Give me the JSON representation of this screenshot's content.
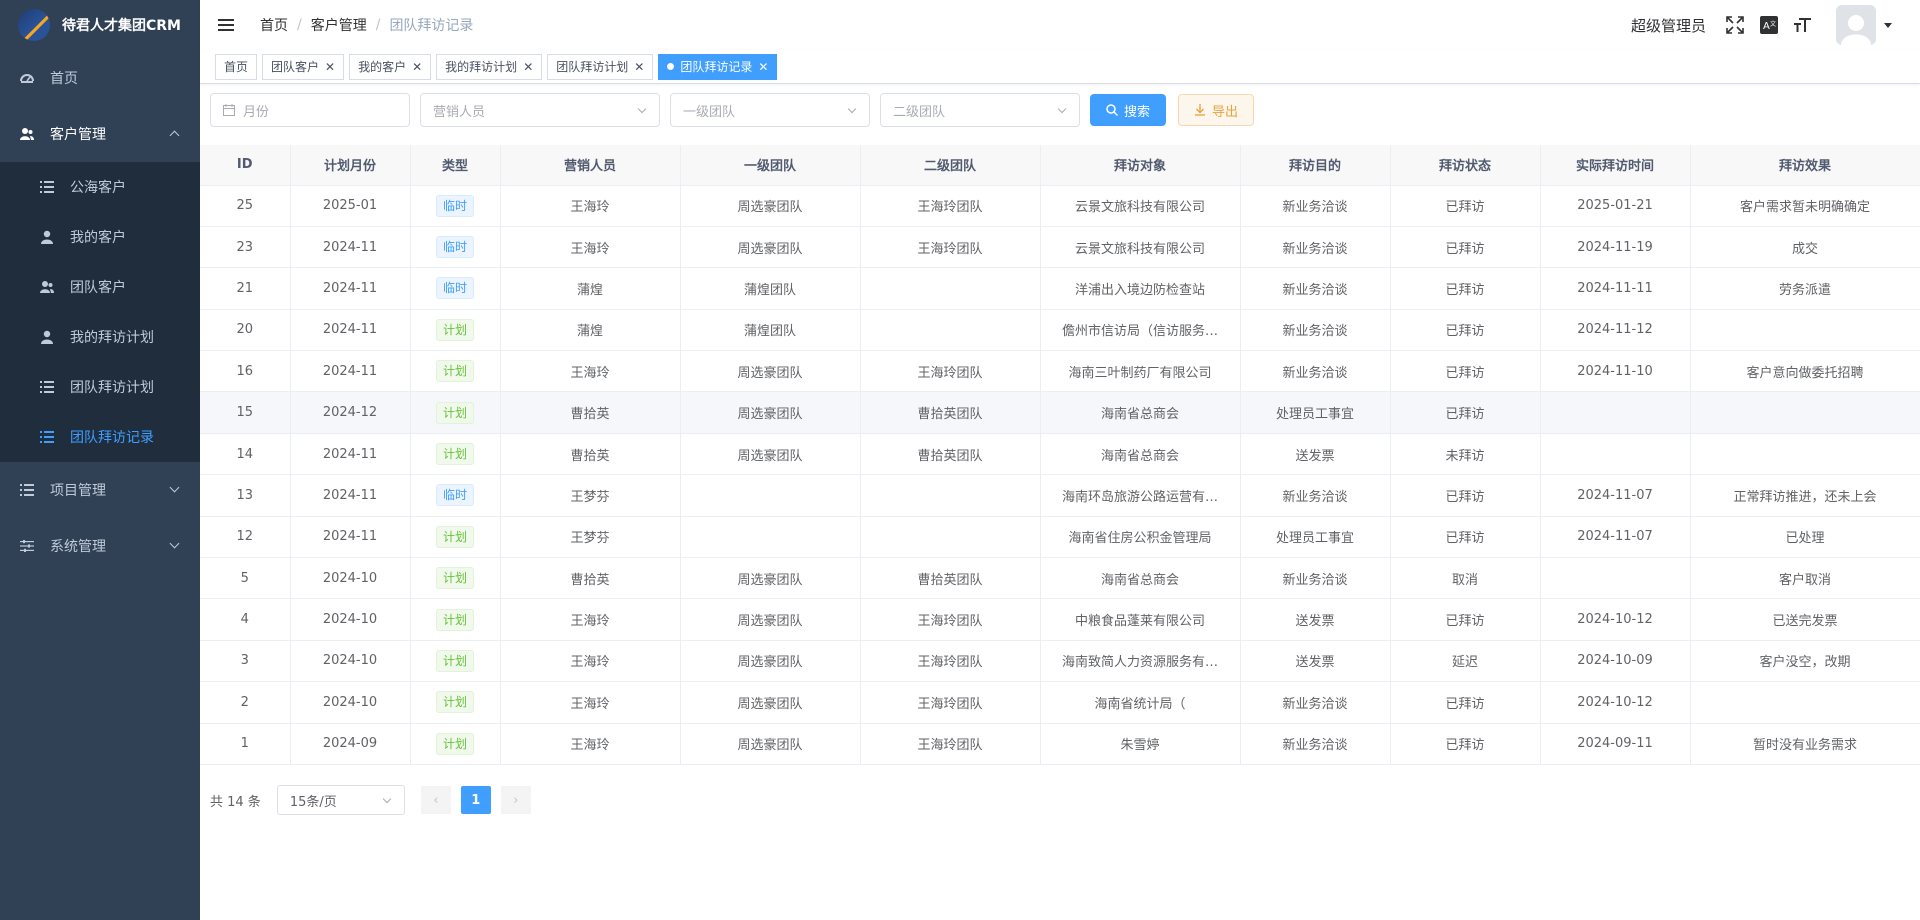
{
  "app": {
    "title": "待君人才集团CRM"
  },
  "sidebar": {
    "home": "首页",
    "customer_mgmt": "客户管理",
    "sub_items": [
      "公海客户",
      "我的客户",
      "团队客户",
      "我的拜访计划",
      "团队拜访计划",
      "团队拜访记录"
    ],
    "project_mgmt": "项目管理",
    "system_mgmt": "系统管理"
  },
  "header": {
    "breadcrumb": [
      "首页",
      "客户管理",
      "团队拜访记录"
    ],
    "username": "超级管理员"
  },
  "tags": [
    "首页",
    "团队客户",
    "我的客户",
    "我的拜访计划",
    "团队拜访计划",
    "团队拜访记录"
  ],
  "filters": {
    "month_placeholder": "月份",
    "sales_placeholder": "营销人员",
    "team1_placeholder": "一级团队",
    "team2_placeholder": "二级团队",
    "search_label": "搜索",
    "export_label": "导出"
  },
  "table": {
    "headers": [
      "ID",
      "计划月份",
      "类型",
      "营销人员",
      "一级团队",
      "二级团队",
      "拜访对象",
      "拜访目的",
      "拜访状态",
      "实际拜访时间",
      "拜访效果"
    ],
    "rows": [
      [
        "25",
        "2025-01",
        "临时",
        "王海玲",
        "周选豪团队",
        "王海玲团队",
        "云景文旅科技有限公司",
        "新业务洽谈",
        "已拜访",
        "2025-01-21",
        "客户需求暂未明确确定"
      ],
      [
        "23",
        "2024-11",
        "临时",
        "王海玲",
        "周选豪团队",
        "王海玲团队",
        "云景文旅科技有限公司",
        "新业务洽谈",
        "已拜访",
        "2024-11-19",
        "成交"
      ],
      [
        "21",
        "2024-11",
        "临时",
        "蒲煌",
        "蒲煌团队",
        "",
        "洋浦出入境边防检查站",
        "新业务洽谈",
        "已拜访",
        "2024-11-11",
        "劳务派遣"
      ],
      [
        "20",
        "2024-11",
        "计划",
        "蒲煌",
        "蒲煌团队",
        "",
        "儋州市信访局（信访服务…",
        "新业务洽谈",
        "已拜访",
        "2024-11-12",
        ""
      ],
      [
        "16",
        "2024-11",
        "计划",
        "王海玲",
        "周选豪团队",
        "王海玲团队",
        "海南三叶制药厂有限公司",
        "新业务洽谈",
        "已拜访",
        "2024-11-10",
        "客户意向做委托招聘"
      ],
      [
        "15",
        "2024-12",
        "计划",
        "曹拾英",
        "周选豪团队",
        "曹拾英团队",
        "海南省总商会",
        "处理员工事宜",
        "已拜访",
        "",
        ""
      ],
      [
        "14",
        "2024-11",
        "计划",
        "曹拾英",
        "周选豪团队",
        "曹拾英团队",
        "海南省总商会",
        "送发票",
        "未拜访",
        "",
        ""
      ],
      [
        "13",
        "2024-11",
        "临时",
        "王梦芬",
        "",
        "",
        "海南环岛旅游公路运营有…",
        "新业务洽谈",
        "已拜访",
        "2024-11-07",
        "正常拜访推进，还未上会"
      ],
      [
        "12",
        "2024-11",
        "计划",
        "王梦芬",
        "",
        "",
        "海南省住房公积金管理局",
        "处理员工事宜",
        "已拜访",
        "2024-11-07",
        "已处理"
      ],
      [
        "5",
        "2024-10",
        "计划",
        "曹拾英",
        "周选豪团队",
        "曹拾英团队",
        "海南省总商会",
        "新业务洽谈",
        "取消",
        "",
        "客户取消"
      ],
      [
        "4",
        "2024-10",
        "计划",
        "王海玲",
        "周选豪团队",
        "王海玲团队",
        "中粮食品蓬莱有限公司",
        "送发票",
        "已拜访",
        "2024-10-12",
        "已送完发票"
      ],
      [
        "3",
        "2024-10",
        "计划",
        "王海玲",
        "周选豪团队",
        "王海玲团队",
        "海南致简人力资源服务有…",
        "送发票",
        "延迟",
        "2024-10-09",
        "客户没空，改期"
      ],
      [
        "2",
        "2024-10",
        "计划",
        "王海玲",
        "周选豪团队",
        "王海玲团队",
        "海南省统计局（",
        "新业务洽谈",
        "已拜访",
        "2024-10-12",
        ""
      ],
      [
        "1",
        "2024-09",
        "计划",
        "王海玲",
        "周选豪团队",
        "王海玲团队",
        "朱雪婷",
        "新业务洽谈",
        "已拜访",
        "2024-09-11",
        "暂时没有业务需求"
      ]
    ]
  },
  "pagination": {
    "total": "共 14 条",
    "page_size": "15条/页",
    "current": "1"
  },
  "colors": {
    "sidebar_bg": "#304156",
    "submenu_bg": "#1f2d3d",
    "accent": "#409eff",
    "tag_blue": "#409eff",
    "tag_green": "#67c23a",
    "warning": "#e6a23c"
  }
}
